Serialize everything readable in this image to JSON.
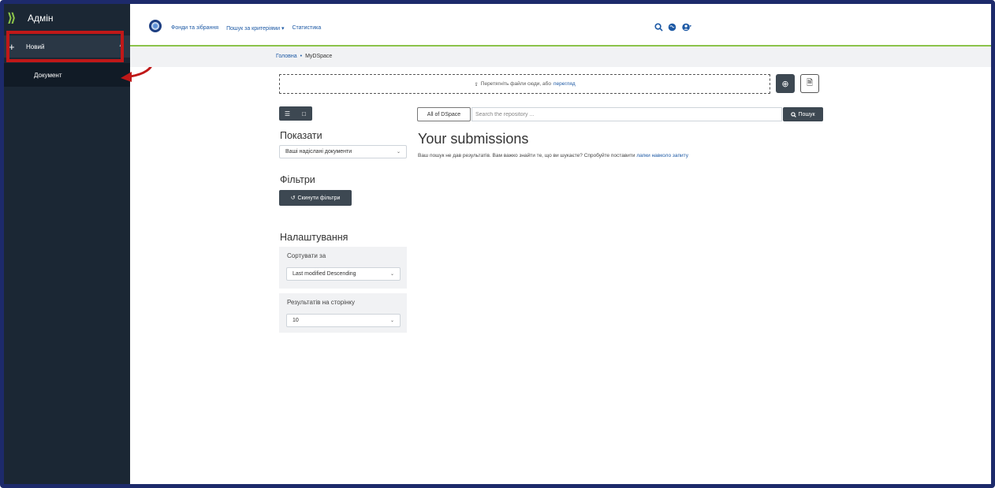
{
  "sidebar": {
    "title": "Адмін",
    "new_label": "Новий",
    "document_label": "Документ"
  },
  "nav": {
    "items": [
      "Фонди та зібрання",
      "Пошук за критеріями ▾",
      "Статистика"
    ]
  },
  "breadcrumb": {
    "home": "Головна",
    "separator": "•",
    "current": "MyDSpace"
  },
  "upload": {
    "text": "Перетягніть файли сюди, або",
    "link": "перегляд"
  },
  "search": {
    "scope": "All of DSpace",
    "placeholder": "Search the repository ...",
    "button": "Пошук"
  },
  "show": {
    "heading": "Показати",
    "selected": "Ваші надіслані документи"
  },
  "filters": {
    "heading": "Фільтри",
    "reset_button": "Скинути фільтри"
  },
  "settings": {
    "heading": "Налаштування",
    "sort_label": "Сортувати за",
    "sort_value": "Last modified Descending",
    "rpp_label": "Результатів на сторінку",
    "rpp_value": "10"
  },
  "main": {
    "heading": "Your submissions",
    "no_results_text": "Ваш пошук не дав результатів. Вам важко знайти те, що ви шукаєте? Спробуйте поставити",
    "no_results_link": "лапки навколо запиту"
  },
  "colors": {
    "sidebar_bg": "#1b2734",
    "accent_green": "#8bc34a",
    "link_blue": "#1e5aa5",
    "highlight_red": "#c01818",
    "button_dark": "#3d4852"
  }
}
